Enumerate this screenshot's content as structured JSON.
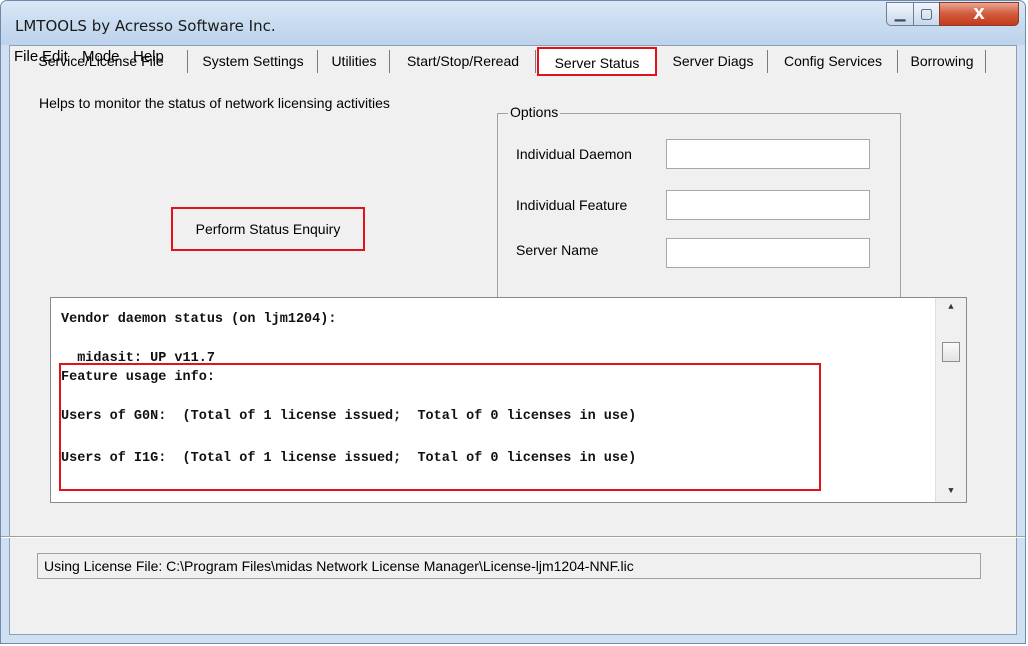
{
  "window": {
    "title": "LMTOOLS by Acresso Software Inc.",
    "min_glyph": "▁",
    "max_glyph": "▢",
    "close_glyph": "X"
  },
  "menu": {
    "items": [
      "File",
      "Edit",
      "Mode",
      "Help"
    ]
  },
  "tabs": [
    "Service/License File",
    "System Settings",
    "Utilities",
    "Start/Stop/Reread",
    "Server Status",
    "Server Diags",
    "Config Services",
    "Borrowing"
  ],
  "active_tab": "Server Status",
  "description": "Helps to monitor the status of network licensing activities",
  "status_button_label": "Perform Status Enquiry",
  "options": {
    "legend": "Options",
    "fields": [
      {
        "label": "Individual Daemon",
        "value": ""
      },
      {
        "label": "Individual Feature",
        "value": ""
      },
      {
        "label": "Server Name",
        "value": ""
      }
    ]
  },
  "output": {
    "lines": [
      "Vendor daemon status (on ljm1204):",
      "  midasit: UP v11.7",
      "Feature usage info:",
      "Users of G0N:  (Total of 1 license issued;  Total of 0 licenses in use)",
      "Users of I1G:  (Total of 1 license issued;  Total of 0 licenses in use)"
    ],
    "scroll_up_glyph": "▲",
    "scroll_down_glyph": "▼"
  },
  "status_bar": "Using License File:  C:\\Program Files\\midas Network License Manager\\License-ljm1204-NNF.lic",
  "colors": {
    "highlight": "#e0121b",
    "window_frame": "#cfe0f2",
    "dialog_bg": "#f0f0f0"
  }
}
